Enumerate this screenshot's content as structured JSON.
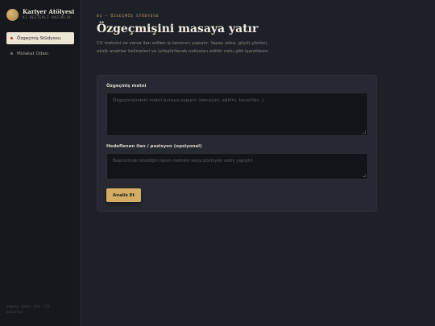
{
  "brand": {
    "name": "Kariyer Atölyesi",
    "tagline": "AI DESTEKLİ HAZIRLIK"
  },
  "sidebar": {
    "items": [
      {
        "label": "Özgeçmiş Stüdyosu",
        "active": true
      },
      {
        "label": "Mülakat Odası",
        "active": false
      }
    ],
    "footer_line1": "yapay zeka ile ilk",
    "footer_line2": "adımlar"
  },
  "main": {
    "eyebrow": "01 — ÖZGEÇMİŞ STÜDYOSU",
    "title": "Özgeçmişini masaya yatır",
    "subtitle": "CV metnini ve varsa ilan edilen iş tanımını yapıştır. Yapay zeka; güçlü yönleri, eksik anahtar kelimeleri ve iyileştirilecek noktaları editör notu gibi işaretlesin."
  },
  "form": {
    "resume_label": "Özgeçmiş metni",
    "resume_placeholder": "Özgeçmişindeki metni buraya yapıştır (deneyim, eğitim, beceriler...)",
    "job_label": "Hedeflenen ilan / pozisyon (opsiyonel)",
    "job_placeholder": "Başvurmak istediğin ilanın metnini veya pozisyon adını yapıştır",
    "submit_label": "Analiz Et"
  },
  "colors": {
    "accent": "#d2ad63",
    "background": "#1e2027",
    "sidebar": "#16181d",
    "panel": "#262931"
  }
}
